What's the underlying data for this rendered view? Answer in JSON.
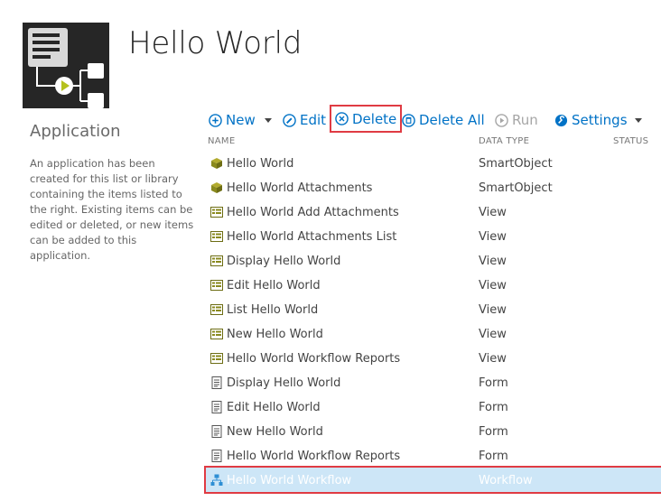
{
  "app": {
    "tile_icon": "workflow-app-icon",
    "title": "Hello World"
  },
  "panel": {
    "title": "Application",
    "description": "An application has been created for this list or library containing the items listed to the right. Existing items can be edited or deleted, or new items can be added to this application."
  },
  "toolbar": {
    "new_label": "New",
    "edit_label": "Edit",
    "delete_label": "Delete",
    "delete_all_label": "Delete All",
    "run_label": "Run",
    "settings_label": "Settings"
  },
  "columns": {
    "name": "NAME",
    "data_type": "DATA TYPE",
    "status": "STATUS"
  },
  "items": [
    {
      "name": "Hello World",
      "type": "SmartObject",
      "icon": "smartobject-icon"
    },
    {
      "name": "Hello World Attachments",
      "type": "SmartObject",
      "icon": "smartobject-icon"
    },
    {
      "name": "Hello World Add Attachments",
      "type": "View",
      "icon": "view-icon"
    },
    {
      "name": "Hello World Attachments List",
      "type": "View",
      "icon": "view-icon"
    },
    {
      "name": "Display Hello World",
      "type": "View",
      "icon": "view-icon"
    },
    {
      "name": "Edit Hello World",
      "type": "View",
      "icon": "view-icon"
    },
    {
      "name": "List Hello World",
      "type": "View",
      "icon": "view-icon"
    },
    {
      "name": "New Hello World",
      "type": "View",
      "icon": "view-icon"
    },
    {
      "name": "Hello World Workflow Reports",
      "type": "View",
      "icon": "view-icon"
    },
    {
      "name": "Display Hello World",
      "type": "Form",
      "icon": "form-icon"
    },
    {
      "name": "Edit Hello World",
      "type": "Form",
      "icon": "form-icon"
    },
    {
      "name": "New Hello World",
      "type": "Form",
      "icon": "form-icon"
    },
    {
      "name": "Hello World Workflow Reports",
      "type": "Form",
      "icon": "form-icon"
    },
    {
      "name": "Hello World Workflow",
      "type": "Workflow",
      "icon": "workflow-icon",
      "selected": true
    }
  ],
  "colors": {
    "accent": "#0072c6",
    "highlight_border": "#e03b43",
    "selected_row": "#cde6f7",
    "smartobject": "#8a8a1e",
    "view": "#7a7a2a"
  }
}
